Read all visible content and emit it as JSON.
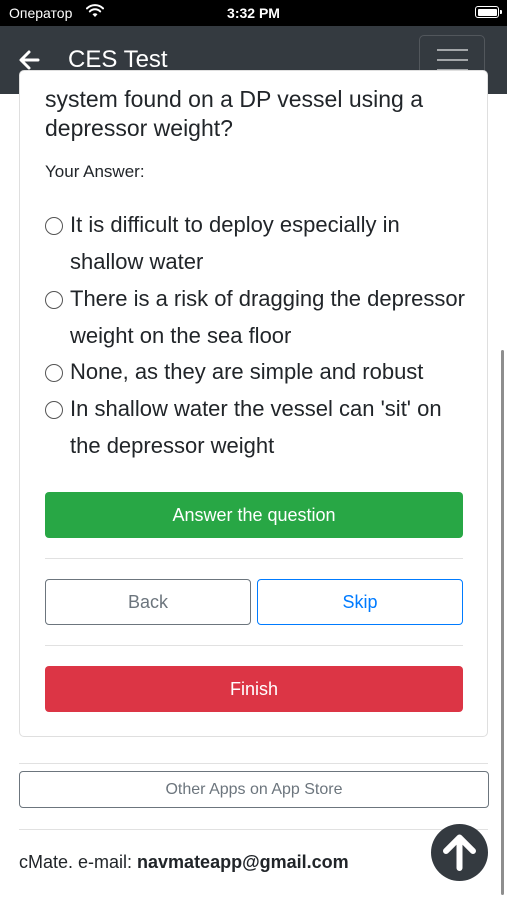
{
  "status_bar": {
    "carrier": "Оператор",
    "time": "3:32 PM"
  },
  "navbar": {
    "title": "CES Test",
    "back_icon": "arrow-left-icon",
    "menu_icon": "hamburger-icon"
  },
  "question": {
    "text": "system found on a DP vessel using a depressor weight?",
    "your_answer_label": "Your Answer:",
    "options": [
      "It is difficult to deploy especially in shallow water",
      "There is a risk of dragging the depressor weight on the sea floor",
      "None, as they are simple and robust",
      "In shallow water the vessel can 'sit' on the depressor weight"
    ]
  },
  "buttons": {
    "answer": "Answer the question",
    "back": "Back",
    "skip": "Skip",
    "finish": "Finish",
    "other_apps": "Other Apps on App Store"
  },
  "footer": {
    "prefix": "cMate. e-mail: ",
    "email": "navmateapp@gmail.com"
  },
  "colors": {
    "navbar": "#343a40",
    "success": "#28a745",
    "danger": "#dc3545",
    "primary": "#007bff",
    "secondary": "#6c757d"
  }
}
